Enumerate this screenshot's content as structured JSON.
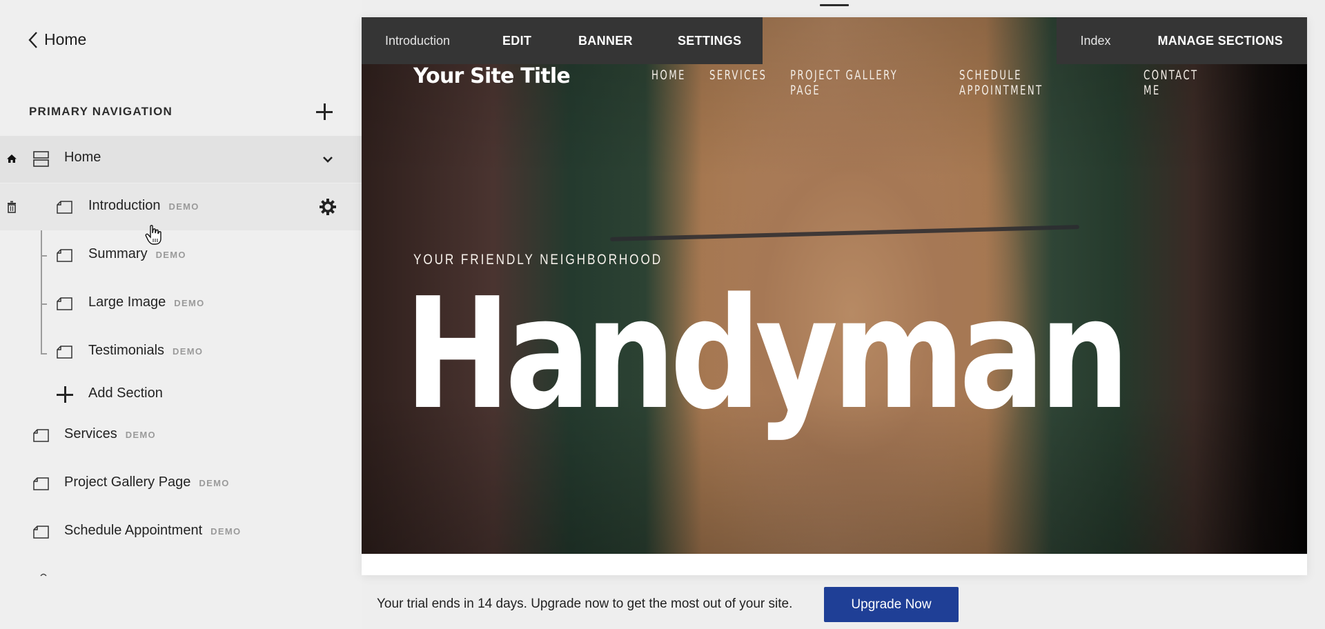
{
  "sidebar": {
    "back_label": "Home",
    "section_title": "PRIMARY NAVIGATION",
    "home_item": {
      "label": "Home",
      "icon": "home-icon"
    },
    "home_sections": [
      {
        "label": "Introduction",
        "badge": "DEMO",
        "active": true
      },
      {
        "label": "Summary",
        "badge": "DEMO"
      },
      {
        "label": "Large Image",
        "badge": "DEMO"
      },
      {
        "label": "Testimonials",
        "badge": "DEMO"
      }
    ],
    "add_section_label": "Add Section",
    "pages": [
      {
        "label": "Services",
        "badge": "DEMO"
      },
      {
        "label": "Project Gallery Page",
        "badge": "DEMO"
      },
      {
        "label": "Schedule Appointment",
        "badge": "DEMO"
      }
    ]
  },
  "preview": {
    "toolbar_left": {
      "context_label": "Introduction",
      "edit": "EDIT",
      "banner": "BANNER",
      "settings": "SETTINGS"
    },
    "toolbar_right": {
      "context_label": "Index",
      "manage_sections": "MANAGE SECTIONS"
    },
    "site": {
      "title": "Your Site Title",
      "nav": [
        "HOME",
        "SERVICES",
        "PROJECT GALLERY PAGE",
        "SCHEDULE APPOINTMENT",
        "CONTACT ME"
      ],
      "eyebrow": "YOUR FRIENDLY NEIGHBORHOOD",
      "headline": "Handyman"
    }
  },
  "banner": {
    "trial_text": "Your trial ends in 14 days. Upgrade now to get the most out of your site.",
    "upgrade_label": "Upgrade Now",
    "upgrade_color": "#1f3f96"
  }
}
